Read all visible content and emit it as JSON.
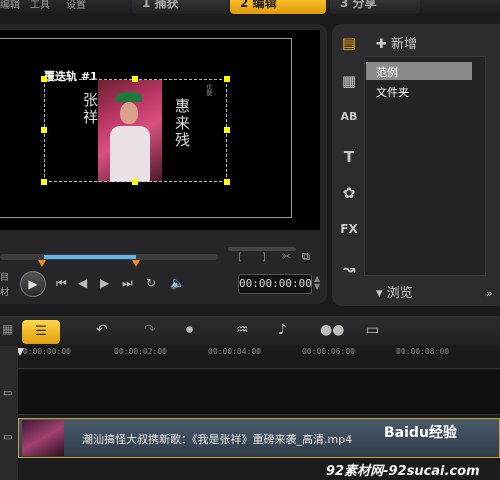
{
  "menu": {
    "items": [
      "编辑",
      "工具",
      "设置"
    ]
  },
  "steps": [
    {
      "num": "1",
      "label": "捕获"
    },
    {
      "num": "2",
      "label": "编辑"
    },
    {
      "num": "3",
      "label": "分享"
    }
  ],
  "preview": {
    "track_label": "覆迭轨 #1",
    "overlay_text_left": "张祥",
    "overlay_text_right": "惠来残",
    "overlay_small_1": "优酷",
    "playback_position": 0.2,
    "timecode": "00:00:00:00"
  },
  "left_labels": [
    "目",
    "材"
  ],
  "library": {
    "add_label": "新增",
    "items": [
      "范例",
      "文件夹"
    ],
    "selected_index": 0,
    "browse_label": "浏览",
    "side_icons": [
      "media-icon",
      "video-filter-icon",
      "ab-transition-icon",
      "title-icon",
      "graphics-icon",
      "fx-icon",
      "path-icon"
    ]
  },
  "timeline": {
    "ruler_ticks": [
      "00:00:00:00",
      "00:00:02:00",
      "00:00:04:00",
      "00:00:06:00",
      "00:00:08:00"
    ],
    "clip_title": "潮汕搞怪大叔携新歌：《我是张祥》重磅来袭_高清.mp4"
  },
  "watermark": {
    "brand": "Baidu经验",
    "site": "92素材网-92sucai.com"
  },
  "colors": {
    "accent": "#f0a818",
    "progress": "#5fb8e8",
    "handle": "#ffff00"
  }
}
